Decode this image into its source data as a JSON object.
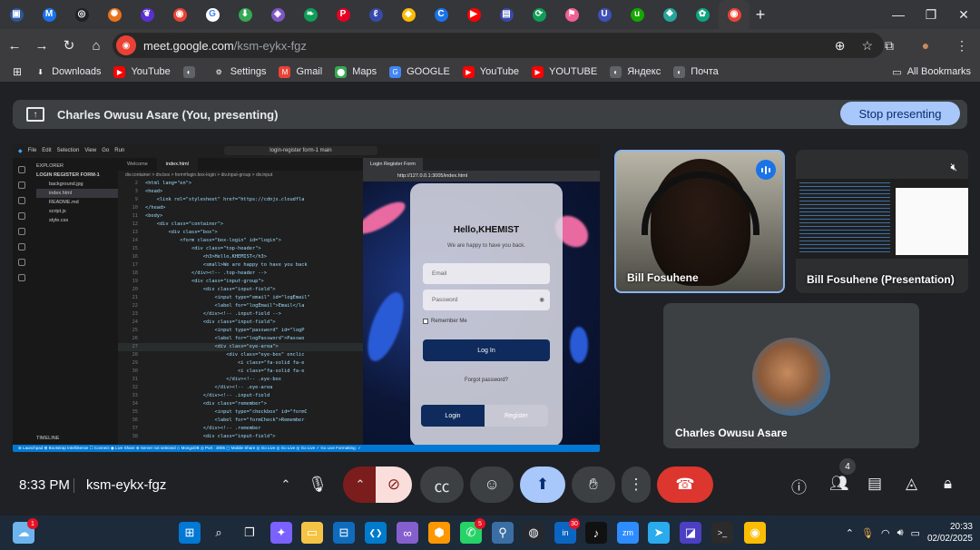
{
  "browser": {
    "url_host": "meet.google.com",
    "url_path": "/ksm-eykx-fgz",
    "tab_count_visible": 24,
    "tabs": [
      {
        "icon": "outlook-icon",
        "color": "#2b579a",
        "glyph": "▣"
      },
      {
        "icon": "gmail-icon",
        "color": "#1a73e8",
        "glyph": "M"
      },
      {
        "icon": "chrome-app-icon",
        "color": "#202124",
        "glyph": "◎"
      },
      {
        "icon": "sunburst-icon",
        "color": "#e8711a",
        "glyph": "✺"
      },
      {
        "icon": "vpn-icon",
        "color": "#5b2fd6",
        "glyph": "❦"
      },
      {
        "icon": "share-icon",
        "color": "#ea4335",
        "glyph": "◉"
      },
      {
        "icon": "google-icon",
        "color": "#ffffff",
        "glyph": "G"
      },
      {
        "icon": "download-site-icon",
        "color": "#34a853",
        "glyph": "⬇"
      },
      {
        "icon": "image-site-icon",
        "color": "#7e57c2",
        "glyph": "◈"
      },
      {
        "icon": "leaf-icon",
        "color": "#0f9d58",
        "glyph": "❧"
      },
      {
        "icon": "pinterest-icon",
        "color": "#e60023",
        "glyph": "P"
      },
      {
        "icon": "clip-icon",
        "color": "#3949ab",
        "glyph": "ℓ"
      },
      {
        "icon": "pin-icon",
        "color": "#fbbc04",
        "glyph": "◆"
      },
      {
        "icon": "c-site-icon",
        "color": "#1a73e8",
        "glyph": "C"
      },
      {
        "icon": "youtube-icon",
        "color": "#ff0000",
        "glyph": "▶"
      },
      {
        "icon": "monitor-icon",
        "color": "#3949ab",
        "glyph": "▤"
      },
      {
        "icon": "sync-icon",
        "color": "#0f9d58",
        "glyph": "⟳"
      },
      {
        "icon": "flag-icon",
        "color": "#f06292",
        "glyph": "⚑"
      },
      {
        "icon": "ui-site-icon",
        "color": "#3f51b5",
        "glyph": "U"
      },
      {
        "icon": "upwork-icon",
        "color": "#14a800",
        "glyph": "u"
      },
      {
        "icon": "grid-site-icon",
        "color": "#26a69a",
        "glyph": "❖"
      },
      {
        "icon": "chatgpt-icon",
        "color": "#10a37f",
        "glyph": "✿"
      },
      {
        "icon": "meet-icon",
        "color": "#ea4335",
        "glyph": "◉"
      },
      {
        "icon": "globe-icon",
        "color": "#5f6368",
        "glyph": "◐"
      },
      {
        "icon": "globe-icon",
        "color": "#5f6368",
        "glyph": "◐"
      }
    ],
    "bookmarks": [
      {
        "label": "Downloads",
        "icon": "download-icon",
        "color": "#3c3c3f",
        "glyph": "⬇"
      },
      {
        "label": "YouTube",
        "icon": "youtube-icon",
        "color": "#ff0000",
        "glyph": "▶"
      },
      {
        "label": "",
        "icon": "globe-icon",
        "color": "#5f6368",
        "glyph": "◐"
      },
      {
        "label": "Settings",
        "icon": "gear-icon",
        "color": "#3c3c3f",
        "glyph": "⚙"
      },
      {
        "label": "Gmail",
        "icon": "gmail-icon",
        "color": "#ea4335",
        "glyph": "M"
      },
      {
        "label": "Maps",
        "icon": "maps-icon",
        "color": "#34a853",
        "glyph": "⬤"
      },
      {
        "label": "GOOGLE",
        "icon": "google-icon",
        "color": "#4285f4",
        "glyph": "G"
      },
      {
        "label": "YouTube",
        "icon": "youtube-icon",
        "color": "#ff0000",
        "glyph": "▶"
      },
      {
        "label": "YOUTUBE",
        "icon": "youtube-icon",
        "color": "#ff0000",
        "glyph": "▶"
      },
      {
        "label": "Яндекс",
        "icon": "globe-icon",
        "color": "#5f6368",
        "glyph": "◐"
      },
      {
        "label": "Почта",
        "icon": "globe-icon",
        "color": "#5f6368",
        "glyph": "◐"
      }
    ],
    "all_bookmarks": "All Bookmarks"
  },
  "meet": {
    "presenter_banner": "Charles Owusu Asare (You, presenting)",
    "stop_presenting": "Stop presenting",
    "participants": [
      {
        "name": "Bill Fosuhene"
      },
      {
        "name": "Bill Fosuhene (Presentation)"
      },
      {
        "name": "Charles Owusu Asare"
      }
    ],
    "time": "8:33 PM",
    "meeting_code": "ksm-eykx-fgz",
    "people_count": "4"
  },
  "shared_screen": {
    "menu": [
      "File",
      "Edit",
      "Selection",
      "View",
      "Go",
      "Run"
    ],
    "search": "login-register form-1 main",
    "explorer": {
      "title": "EXPLORER",
      "project": "LOGIN REGISTER FORM-1",
      "files": [
        "background.jpg",
        "index.html",
        "README.md",
        "script.js",
        "style.css"
      ],
      "timeline": "TIMELINE"
    },
    "editor_tabs": [
      "Welcome",
      "index.html"
    ],
    "breadcrumb": "div.container > div.box > form#login.box-login > div.input-group > div.input",
    "code": [
      {
        "n": "2",
        "t": "<html lang=\"en\">"
      },
      {
        "n": "3",
        "t": "<head>"
      },
      {
        "n": "9",
        "t": "    <link rel=\"stylesheet\" href=\"https://cdnjs.cloudfla"
      },
      {
        "n": "10",
        "t": "</head>"
      },
      {
        "n": "11",
        "t": "<body>"
      },
      {
        "n": "12",
        "t": "    <div class=\"container\">"
      },
      {
        "n": "13",
        "t": "        <div class=\"box\">"
      },
      {
        "n": "14",
        "t": "            <form class=\"box-login\" id=\"login\">"
      },
      {
        "n": "15",
        "t": "                <div class=\"top-header\">"
      },
      {
        "n": "16",
        "t": "                    <h3>Hello,KHEMIST</h3>"
      },
      {
        "n": "17",
        "t": "                    <small>We are happy to have you back"
      },
      {
        "n": "18",
        "t": "                </div><!-- .top-header -->"
      },
      {
        "n": "19",
        "t": "                <div class=\"input-group\">"
      },
      {
        "n": "20",
        "t": "                    <div class=\"input-field\">"
      },
      {
        "n": "21",
        "t": "                        <input type=\"email\" id=\"logEmail\""
      },
      {
        "n": "22",
        "t": "                        <label for=\"logEmail\">Email</la"
      },
      {
        "n": "23",
        "t": "                    </div><!-- .input-field -->"
      },
      {
        "n": "24",
        "t": "                    <div class=\"input-field\">"
      },
      {
        "n": "25",
        "t": "                        <input type=\"password\" id=\"logP"
      },
      {
        "n": "26",
        "t": "                        <label for=\"logPassword\">Passwo"
      },
      {
        "n": "27",
        "t": "                        <div class=\"eye-area\">"
      },
      {
        "n": "28",
        "t": "                            <div class=\"eye-box\" onclic"
      },
      {
        "n": "29",
        "t": "                                <i class=\"fa-solid fa-e"
      },
      {
        "n": "30",
        "t": "                                <i class=\"fa-solid fa-e"
      },
      {
        "n": "31",
        "t": "                            </div><!-- .eye-box"
      },
      {
        "n": "32",
        "t": "                        </div><!-- .eye-area"
      },
      {
        "n": "33",
        "t": "                    </div><!-- .input-field"
      },
      {
        "n": "34",
        "t": "                    <div class=\"remember\">"
      },
      {
        "n": "35",
        "t": "                        <input type=\"checkbox\" id=\"formC"
      },
      {
        "n": "36",
        "t": "                        <label for=\"formCheck\">Remember"
      },
      {
        "n": "37",
        "t": "                    </div><!-- .remember"
      },
      {
        "n": "38",
        "t": "                    <div class=\"input-field\">"
      }
    ],
    "preview_tab": "Login Register Form",
    "preview_url": "http://127.0.0.1:3005/index.html",
    "form": {
      "heading": "Hello,KHEMIST",
      "subheading": "We are happy to have you back.",
      "email_placeholder": "Email",
      "password_placeholder": "Password",
      "remember": "Remember Me",
      "login_button": "Log In",
      "forgot": "Forgot password?",
      "seg_login": "Login",
      "seg_register": "Register"
    },
    "statusbar": "⊗ Launchpad   ⊞ Bootstrap IntelliSense   ☐ Connect   ◉ Live Share   ⊗ Server not selected   ◇ MongoDB                              ◎ Port : 3005   ▢ Mobile Share   ◎ Go Live   ◎ Go Live   ◎ Go Live   ✓ Go Live   Formatting: ✓"
  },
  "taskbar": {
    "apps": [
      {
        "icon": "weather-icon",
        "glyph": "☁",
        "color": "#6cb4ee",
        "badge": "1"
      },
      {
        "icon": "windows-start-icon",
        "glyph": "⊞",
        "color": "#0078d4",
        "badge": ""
      },
      {
        "icon": "search-icon",
        "glyph": "⌕",
        "color": "transparent",
        "badge": ""
      },
      {
        "icon": "task-view-icon",
        "glyph": "❐",
        "color": "transparent",
        "badge": ""
      },
      {
        "icon": "copilot-icon",
        "glyph": "✦",
        "color": "#7b61ff",
        "badge": ""
      },
      {
        "icon": "file-explorer-icon",
        "glyph": "▭",
        "color": "#f6c445",
        "badge": ""
      },
      {
        "icon": "store-icon",
        "glyph": "⊟",
        "color": "#0f6cbd",
        "badge": ""
      },
      {
        "icon": "vscode-icon",
        "glyph": "❮❯",
        "color": "#007acc",
        "badge": ""
      },
      {
        "icon": "visual-studio-icon",
        "glyph": "∞",
        "color": "#865fcf",
        "badge": ""
      },
      {
        "icon": "sublime-icon",
        "glyph": "⬢",
        "color": "#ff9800",
        "badge": ""
      },
      {
        "icon": "whatsapp-icon",
        "glyph": "✆",
        "color": "#25d366",
        "badge": "5"
      },
      {
        "icon": "app-icon",
        "glyph": "⚲",
        "color": "#3a6ea5",
        "badge": ""
      },
      {
        "icon": "github-icon",
        "glyph": "◍",
        "color": "#24292f",
        "badge": ""
      },
      {
        "icon": "linkedin-icon",
        "glyph": "in",
        "color": "#0a66c2",
        "badge": "30"
      },
      {
        "icon": "tiktok-icon",
        "glyph": "♪",
        "color": "#111111",
        "badge": ""
      },
      {
        "icon": "zoom-icon",
        "glyph": "zm",
        "color": "#2d8cff",
        "badge": ""
      },
      {
        "icon": "telegram-icon",
        "glyph": "➤",
        "color": "#2aabee",
        "badge": ""
      },
      {
        "icon": "app2-icon",
        "glyph": "◪",
        "color": "#4b3fc4",
        "badge": ""
      },
      {
        "icon": "terminal-icon",
        "glyph": ">_",
        "color": "#2b2b2b",
        "badge": ""
      },
      {
        "icon": "chrome-icon",
        "glyph": "◉",
        "color": "#fbbc04",
        "badge": ""
      }
    ],
    "time": "20:33",
    "date": "02/02/2025"
  }
}
